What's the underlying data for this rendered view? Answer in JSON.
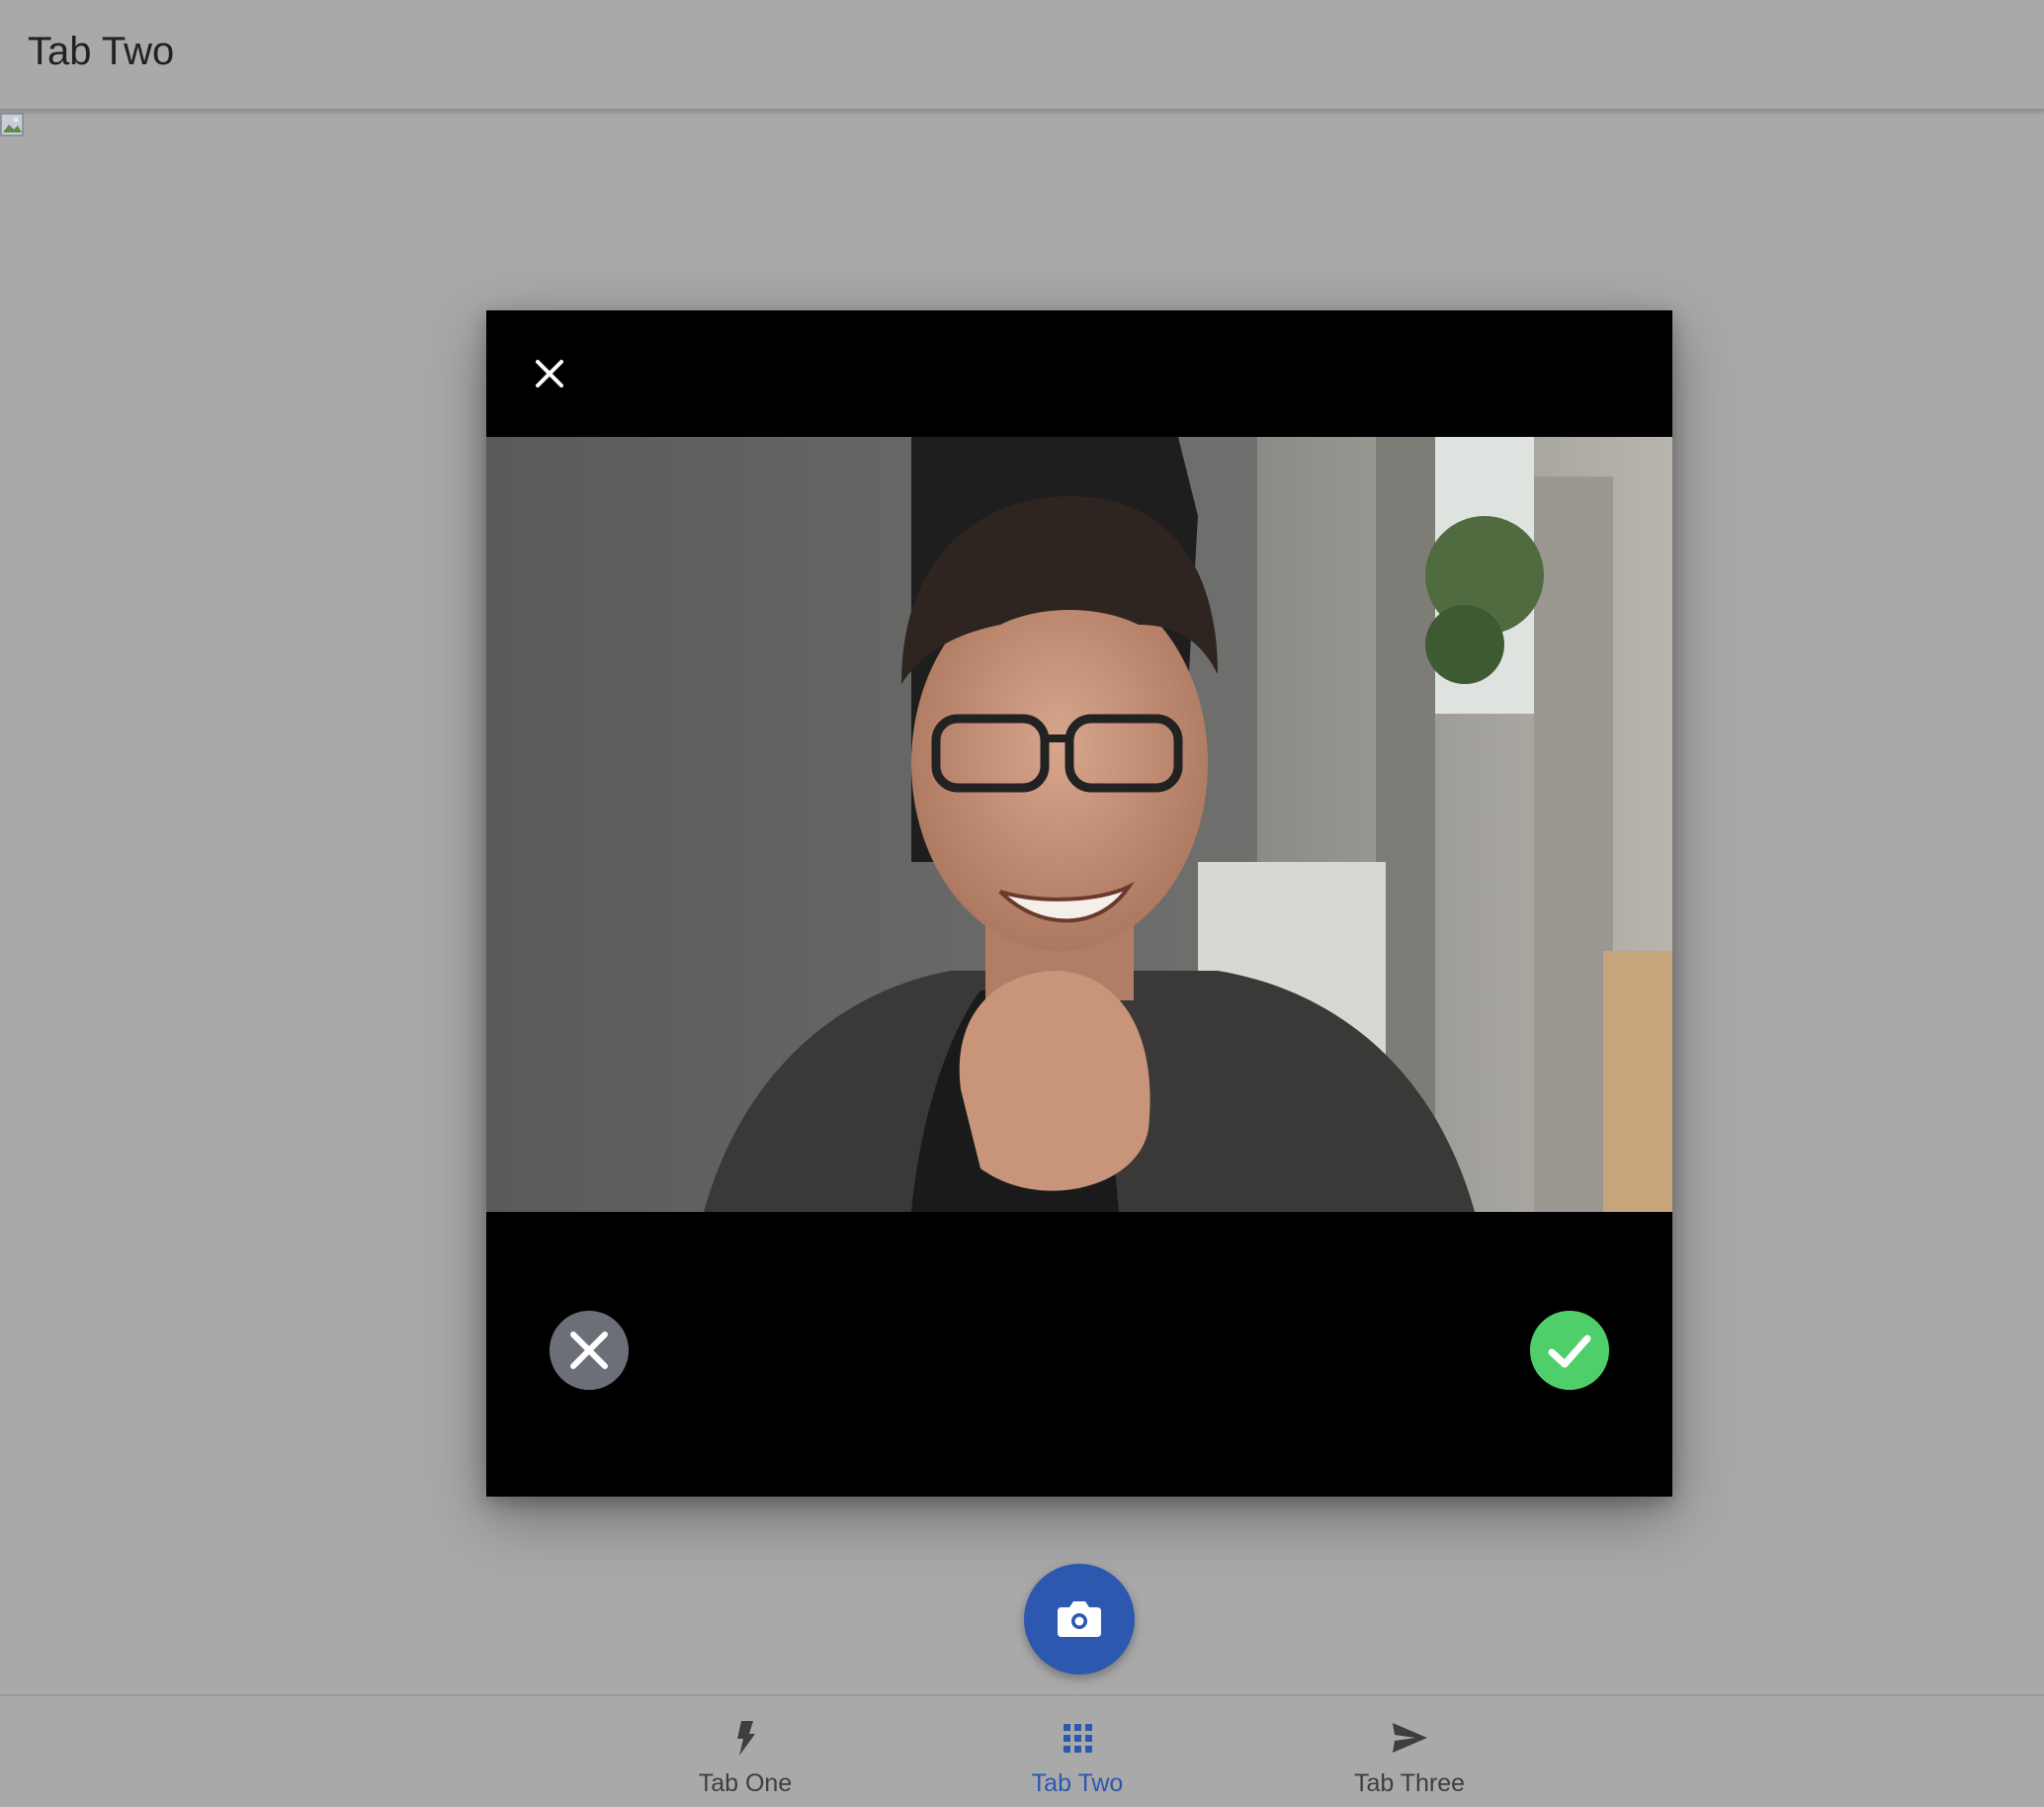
{
  "header": {
    "title": "Tab Two"
  },
  "modal": {
    "close_icon": "close-icon",
    "photo": "selfie-photo",
    "discard_icon": "discard-circle-x-icon",
    "accept_icon": "accept-check-icon",
    "colors": {
      "background": "#000000",
      "discard": "#6c6f78",
      "accept": "#4fcf6a"
    }
  },
  "fab": {
    "icon": "camera-icon",
    "color": "#2c58b0"
  },
  "tabs": [
    {
      "label": "Tab One",
      "icon": "flash-icon",
      "active": false
    },
    {
      "label": "Tab Two",
      "icon": "apps-grid-icon",
      "active": true
    },
    {
      "label": "Tab Three",
      "icon": "send-icon",
      "active": false
    }
  ],
  "colors": {
    "accent": "#2c58b0",
    "backdrop": "#a9a9a9"
  }
}
